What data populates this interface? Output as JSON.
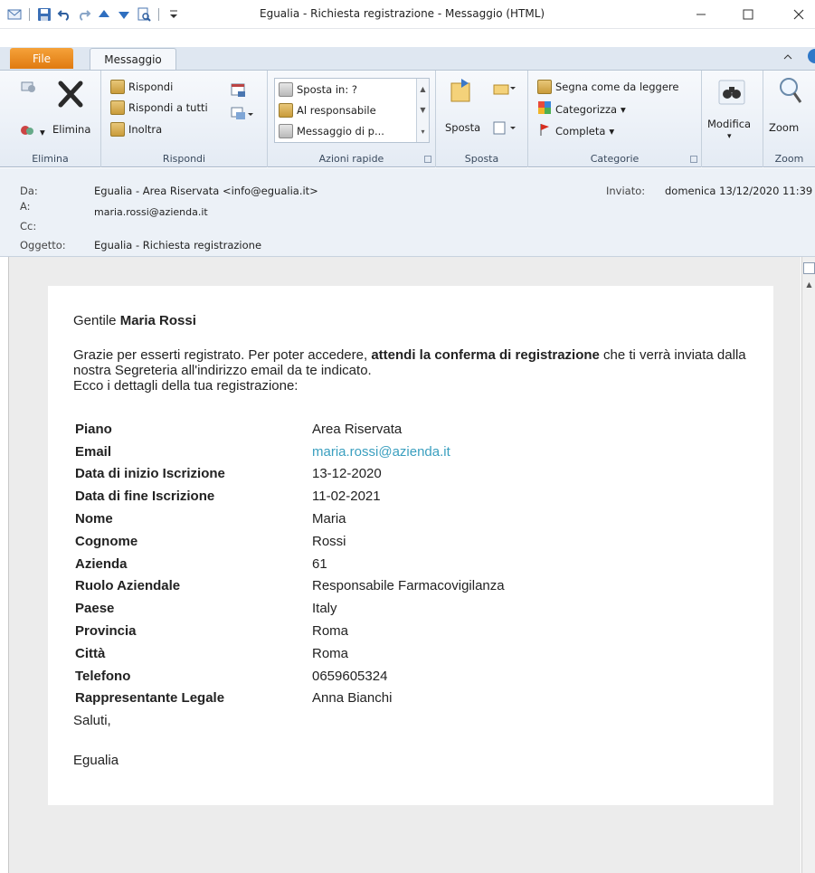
{
  "window": {
    "title": "Egualia - Richiesta registrazione  -  Messaggio (HTML)",
    "minimize_icon": "minimize-icon",
    "maximize_icon": "maximize-icon",
    "close_icon": "close-icon"
  },
  "tabs": {
    "file": "File",
    "message": "Messaggio"
  },
  "ribbon": {
    "delete_group": {
      "delete_label": "Elimina",
      "group_label": "Elimina"
    },
    "respond_group": {
      "reply": "Rispondi",
      "reply_all": "Rispondi a tutti",
      "forward": "Inoltra",
      "group_label": "Rispondi"
    },
    "quick_steps": {
      "items": [
        "Sposta in: ?",
        "Al responsabile",
        "Messaggio di p..."
      ],
      "group_label": "Azioni rapide"
    },
    "move_group": {
      "move": "Sposta",
      "group_label": "Sposta"
    },
    "tags_group": {
      "mark_unread": "Segna come da leggere",
      "categorize": "Categorizza",
      "followup": "Completa",
      "group_label": "Categorie"
    },
    "edit_group": {
      "edit": "Modifica"
    },
    "zoom_group": {
      "zoom": "Zoom",
      "group_label": "Zoom"
    }
  },
  "header": {
    "from_label": "Da:",
    "from_value": "Egualia - Area Riservata <info@egualia.it>",
    "sent_label": "Inviato:",
    "sent_value": "domenica 13/12/2020 11:39",
    "to_label": "A:",
    "to_value": "maria.rossi@azienda.it",
    "cc_label": "Cc:",
    "subject_label": "Oggetto:",
    "subject_value": "Egualia - Richiesta registrazione"
  },
  "email": {
    "greeting_prefix": "Gentile ",
    "greeting_name": "Maria Rossi",
    "intro_part1": "Grazie per esserti registrato. Per poter accedere, ",
    "intro_bold": "attendi la conferma di registrazione",
    "intro_part2": " che ti verrà inviata dalla nostra Segreteria all'indirizzo email da te indicato.",
    "intro_line3": "Ecco i dettagli della tua registrazione:",
    "details": [
      {
        "key": "Piano",
        "value": "Area Riservata"
      },
      {
        "key": "Email",
        "value": "maria.rossi@azienda.it"
      },
      {
        "key": "Data di inizio Iscrizione",
        "value": "13-12-2020"
      },
      {
        "key": "Data di fine Iscrizione",
        "value": "11-02-2021"
      },
      {
        "key": "Nome",
        "value": "Maria"
      },
      {
        "key": "Cognome",
        "value": "Rossi"
      },
      {
        "key": "Azienda",
        "value": "61"
      },
      {
        "key": "Ruolo Aziendale",
        "value": "Responsabile Farmacovigilanza"
      },
      {
        "key": "Paese",
        "value": "Italy"
      },
      {
        "key": "Provincia",
        "value": "Roma"
      },
      {
        "key": "Città",
        "value": "Roma"
      },
      {
        "key": "Telefono",
        "value": "0659605324"
      },
      {
        "key": "Rappresentante Legale",
        "value": "Anna Bianchi"
      }
    ],
    "closing": "Saluti,",
    "signature": "Egualia"
  },
  "colors": {
    "file_tab": "#e98a1f",
    "link": "#3a9fbf",
    "ribbon_bg": "#e4ebf4"
  }
}
